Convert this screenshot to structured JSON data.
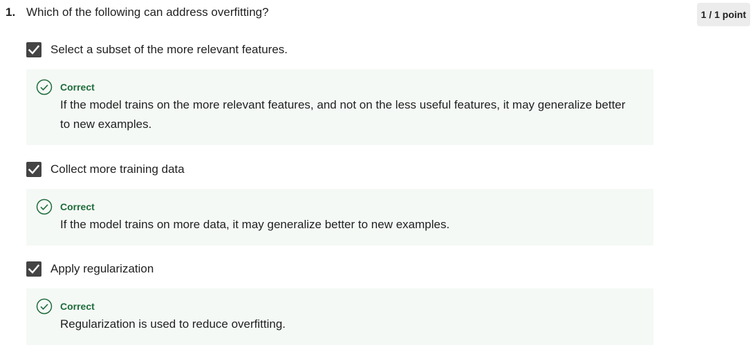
{
  "question": {
    "number": "1.",
    "text": "Which of the following can address overfitting?",
    "points": "1 / 1 point"
  },
  "options": [
    {
      "label": "Select a subset of the more relevant features.",
      "checked": true,
      "feedback_title": "Correct",
      "feedback_text": "If the model trains on the more relevant features, and not on the less useful features, it may generalize better to new examples."
    },
    {
      "label": "Collect more training data",
      "checked": true,
      "feedback_title": "Correct",
      "feedback_text": "If the model trains on more data, it may generalize better to new examples."
    },
    {
      "label": "Apply regularization",
      "checked": true,
      "feedback_title": "Correct",
      "feedback_text": "Regularization is used to reduce overfitting."
    }
  ],
  "icons": {
    "checkbox": "checkmark-icon",
    "feedback": "check-circle-icon"
  },
  "colors": {
    "checkbox_fill": "#444444",
    "feedback_bg": "#f5f9f6",
    "correct_green": "#1d6b3a",
    "badge_bg": "#ececec"
  }
}
